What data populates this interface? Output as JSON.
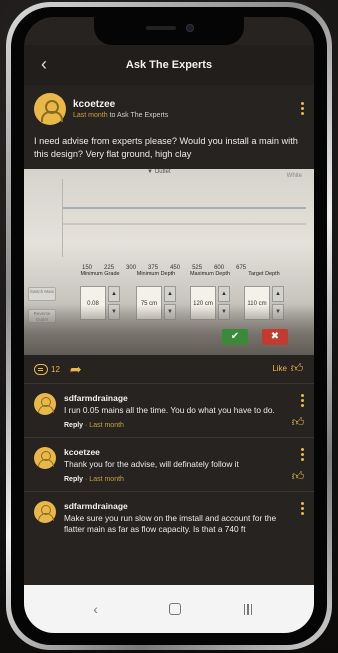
{
  "header": {
    "title": "Ask The Experts"
  },
  "post": {
    "user": "kcoetzee",
    "time": "Last month",
    "to_word": "to",
    "group": "Ask The Experts",
    "text": "I need advise from experts please? Would you install a main with this design? Very flat ground, high clay",
    "comment_count": "12",
    "like_label": "Like"
  },
  "photo": {
    "outlet_label": "Outlet",
    "white_label": "White",
    "scale": [
      "150",
      "225",
      "300",
      "375",
      "450",
      "525",
      "600",
      "675"
    ],
    "side_buttons": [
      "Switch Main",
      "Reverse Outlet"
    ],
    "controls": [
      {
        "label": "Minimum Grade",
        "value": "0.08"
      },
      {
        "label": "Minimum Depth",
        "value": "75 cm"
      },
      {
        "label": "Maximum Depth",
        "value": "120 cm"
      },
      {
        "label": "Target Depth",
        "value": "110 cm"
      }
    ],
    "ok_glyph": "✔",
    "cancel_glyph": "✖"
  },
  "comments": [
    {
      "user": "sdfarmdrainage",
      "text": "I run 0.05 mains all the time.  You do what you have to do.",
      "reply": "Reply",
      "when": "Last month"
    },
    {
      "user": "kcoetzee",
      "text": "Thank you for the advise, will  definately follow it",
      "reply": "Reply",
      "when": "Last month"
    },
    {
      "user": "sdfarmdrainage",
      "text": "Make sure you run slow on the imstall and account for the flatter main as far as flow capacity.   Is that a 740 ft",
      "reply": "",
      "when": ""
    }
  ],
  "icons": {
    "back": "‹",
    "share": "➦",
    "thumb": "👍",
    "nav_back": "‹"
  },
  "colors": {
    "accent": "#e8b94a",
    "background": "#262321"
  }
}
